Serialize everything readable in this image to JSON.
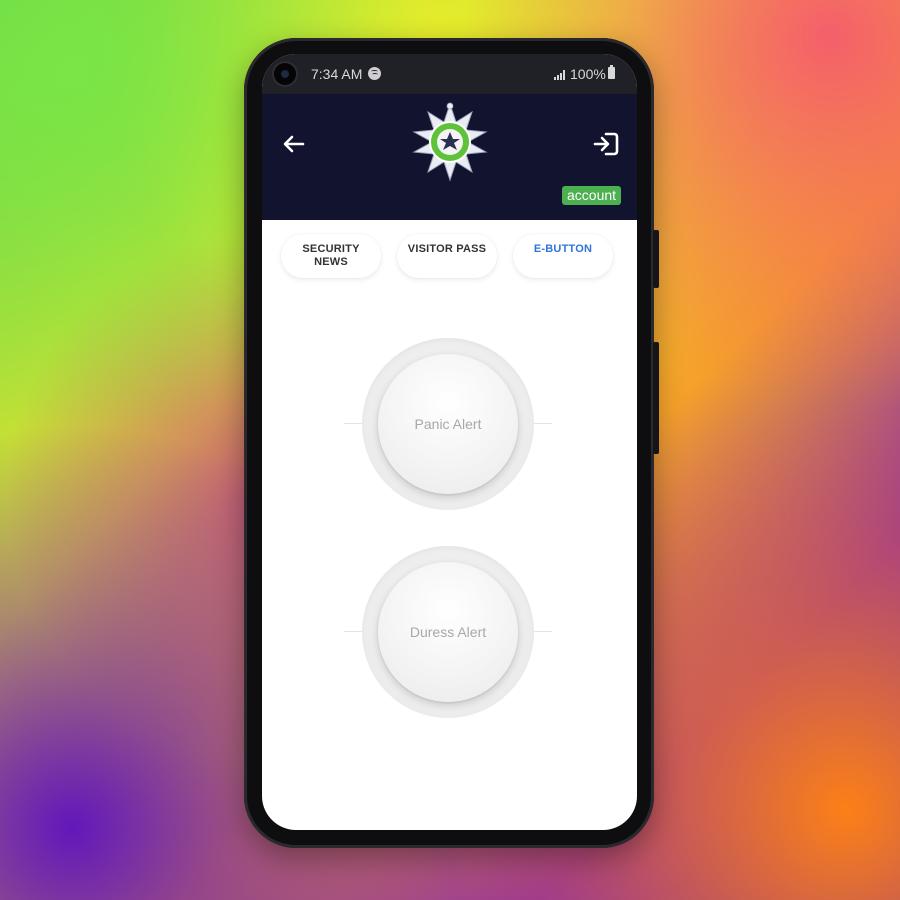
{
  "status_bar": {
    "time": "7:34 AM",
    "battery": "100%",
    "icons": [
      "spotify-icon",
      "signal-icon",
      "battery-icon"
    ]
  },
  "header": {
    "back_icon": "arrow-left-icon",
    "logo_icon": "security-star-badge-icon",
    "logout_icon": "sign-in-arrow-icon",
    "account_label": "account",
    "background": "#12132f",
    "account_color": "#4caf50"
  },
  "tabs": [
    {
      "label": "SECURITY\nNEWS",
      "active": false
    },
    {
      "label": "VISITOR PASS",
      "active": false
    },
    {
      "label": "E-BUTTON",
      "active": true
    }
  ],
  "alerts": {
    "panic_label": "Panic Alert",
    "duress_label": "Duress Alert"
  },
  "colors": {
    "active_tab": "#2f73e0"
  }
}
